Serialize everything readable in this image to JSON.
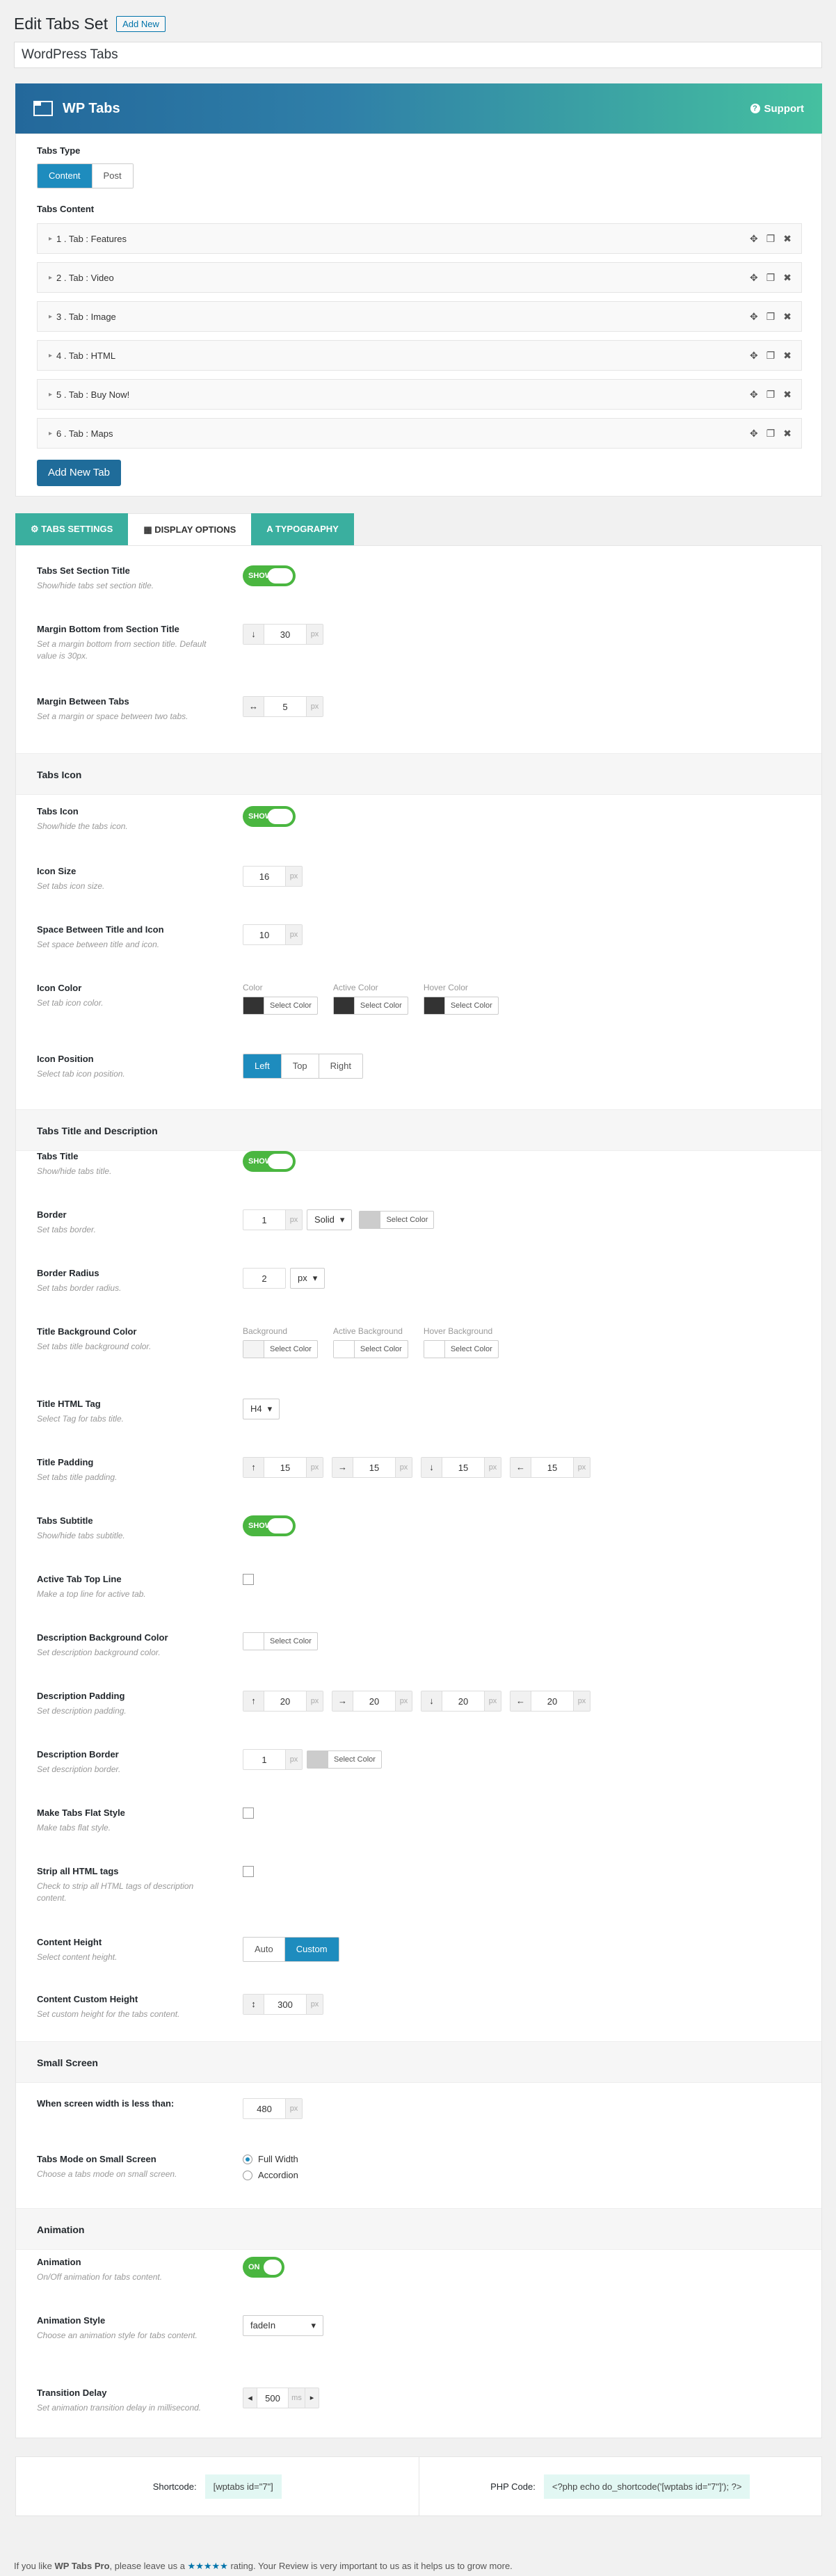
{
  "header": {
    "title": "Edit Tabs Set",
    "add_new": "Add New"
  },
  "tabs_set_title": "WordPress Tabs",
  "banner": {
    "logo": "WP Tabs",
    "support": "Support"
  },
  "tabs_type": {
    "label": "Tabs Type",
    "options": [
      "Content",
      "Post"
    ],
    "selected": "Content"
  },
  "tabs_content": {
    "label": "Tabs Content",
    "items": [
      "1 .  Tab : Features",
      "2 .  Tab : Video",
      "3 .  Tab : Image",
      "4 .  Tab : HTML",
      "5 .  Tab : Buy Now!",
      "6 .  Tab : Maps"
    ],
    "add_button": "Add New Tab"
  },
  "option_tabs": [
    "TABS SETTINGS",
    "DISPLAY OPTIONS",
    "TYPOGRAPHY"
  ],
  "display": {
    "section_title": {
      "title": "Tabs Set Section Title",
      "desc": "Show/hide tabs set section title.",
      "toggle": "SHOW"
    },
    "margin_bottom": {
      "title": "Margin Bottom from Section Title",
      "desc": "Set a margin bottom from section title. Default value is 30px.",
      "value": "30",
      "unit": "px"
    },
    "margin_between": {
      "title": "Margin Between Tabs",
      "desc": "Set a margin or space between two tabs.",
      "value": "5",
      "unit": "px"
    },
    "sec_icon": "Tabs Icon",
    "tabs_icon": {
      "title": "Tabs Icon",
      "desc": "Show/hide the tabs icon.",
      "toggle": "SHOW"
    },
    "icon_size": {
      "title": "Icon Size",
      "desc": "Set tabs icon size.",
      "value": "16",
      "unit": "px"
    },
    "icon_space": {
      "title": "Space Between Title and Icon",
      "desc": "Set space between title and icon.",
      "value": "10",
      "unit": "px"
    },
    "icon_color": {
      "title": "Icon Color",
      "desc": "Set tab icon color.",
      "labels": [
        "Color",
        "Active Color",
        "Hover Color"
      ],
      "btn": "Select Color"
    },
    "icon_position": {
      "title": "Icon Position",
      "desc": "Select tab icon position.",
      "options": [
        "Left",
        "Top",
        "Right"
      ],
      "selected": "Left"
    },
    "sec_title": "Tabs Title and Description",
    "tabs_title": {
      "title": "Tabs Title",
      "desc": "Show/hide tabs title.",
      "toggle": "SHOW"
    },
    "border": {
      "title": "Border",
      "desc": "Set tabs border.",
      "value": "1",
      "unit": "px",
      "style": "Solid",
      "btn": "Select Color"
    },
    "border_radius": {
      "title": "Border Radius",
      "desc": "Set tabs border radius.",
      "value": "2",
      "unit": "px"
    },
    "title_bg": {
      "title": "Title Background Color",
      "desc": "Set tabs title background color.",
      "labels": [
        "Background",
        "Active Background",
        "Hover Background"
      ],
      "btn": "Select Color"
    },
    "html_tag": {
      "title": "Title HTML Tag",
      "desc": "Select Tag for tabs title.",
      "value": "H4"
    },
    "title_padding": {
      "title": "Title Padding",
      "desc": "Set tabs title padding.",
      "values": [
        "15",
        "15",
        "15",
        "15"
      ],
      "unit": "px"
    },
    "subtitle": {
      "title": "Tabs Subtitle",
      "desc": "Show/hide tabs subtitle.",
      "toggle": "SHOW"
    },
    "top_line": {
      "title": "Active Tab Top Line",
      "desc": "Make a top line for active tab."
    },
    "desc_bg": {
      "title": "Description Background Color",
      "desc": "Set description background color.",
      "btn": "Select Color"
    },
    "desc_padding": {
      "title": "Description Padding",
      "desc": "Set description padding.",
      "values": [
        "20",
        "20",
        "20",
        "20"
      ],
      "unit": "px"
    },
    "desc_border": {
      "title": "Description Border",
      "desc": "Set description border.",
      "value": "1",
      "unit": "px",
      "btn": "Select Color"
    },
    "flat": {
      "title": "Make Tabs Flat Style",
      "desc": "Make tabs flat style."
    },
    "strip": {
      "title": "Strip all HTML tags",
      "desc": "Check to strip all HTML tags of description content."
    },
    "content_height": {
      "title": "Content Height",
      "desc": "Select content height.",
      "options": [
        "Auto",
        "Custom"
      ],
      "selected": "Custom"
    },
    "custom_height": {
      "title": "Content Custom Height",
      "desc": "Set custom height for the tabs content.",
      "value": "300",
      "unit": "px"
    },
    "sec_small": "Small Screen",
    "screen_width": {
      "title": "When screen width is less than:",
      "value": "480",
      "unit": "px"
    },
    "small_mode": {
      "title": "Tabs Mode on Small Screen",
      "desc": "Choose a tabs mode on small screen.",
      "options": [
        "Full Width",
        "Accordion"
      ],
      "selected": "Full Width"
    },
    "sec_anim": "Animation",
    "animation": {
      "title": "Animation",
      "desc": "On/Off animation for tabs content.",
      "toggle": "ON"
    },
    "anim_style": {
      "title": "Animation Style",
      "desc": "Choose an animation style for tabs content.",
      "value": "fadeIn"
    },
    "transition": {
      "title": "Transition Delay",
      "desc": "Set animation transition delay in millisecond.",
      "value": "500",
      "unit": "ms"
    }
  },
  "shortcode": {
    "label": "Shortcode:",
    "value": "[wptabs id=\"7\"]"
  },
  "phpcode": {
    "label": "PHP Code:",
    "value": "<?php echo do_shortcode('[wptabs id=\"7\"]'); ?>"
  },
  "footer": {
    "pre": "If you like ",
    "name": "WP Tabs Pro",
    "mid": ", please leave us a ",
    "stars": "★★★★★",
    "post": " rating. Your Review is very important to us as it helps us to grow more."
  }
}
